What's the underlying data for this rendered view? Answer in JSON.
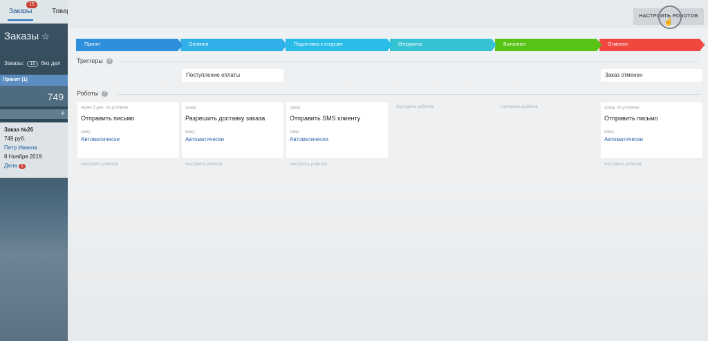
{
  "crm": {
    "tabs": [
      {
        "label": "Заказы",
        "badge": "15"
      },
      {
        "label": "Товар"
      }
    ],
    "title": "Заказы",
    "orders_label": "Заказы:",
    "orders_count": "15",
    "orders_suffix": "без дел",
    "stage_name": "Принят",
    "stage_count": "(1)",
    "stage_sum": "749",
    "add": "+",
    "order": {
      "number": "Заказ №26",
      "price": "749 руб.",
      "client": "Петр Иванов",
      "date": "8 Ноября 2019",
      "deals_label": "Дела",
      "deals_count": "1"
    }
  },
  "toolbar": {
    "setup_robots": "НАСТРОИТЬ РОБОТОВ"
  },
  "stages": [
    {
      "label": "Принят",
      "color": "#2e90dc"
    },
    {
      "label": "Оплачен",
      "color": "#2fb0e8"
    },
    {
      "label": "Подготовка к отгрузке",
      "color": "#29bce8"
    },
    {
      "label": "Отгружено",
      "color": "#35c3d4"
    },
    {
      "label": "Выполнен",
      "color": "#57c314"
    },
    {
      "label": "Отменен",
      "color": "#f0473f"
    }
  ],
  "triggers": {
    "label": "Триггеры",
    "items": [
      {
        "label": "Поступление оплаты"
      },
      {
        "label": "Заказ отменен"
      }
    ]
  },
  "robots": {
    "label": "Роботы",
    "setup_link": "Настроить роботов",
    "cards": [
      {
        "condition": "через 3 дня, по условию",
        "name": "Отправить письмо",
        "to_label": "кому:",
        "to_value": "Автоматически"
      },
      {
        "condition": "сразу",
        "name": "Разрешить доставку заказа",
        "to_label": "кому:",
        "to_value": "Автоматически"
      },
      {
        "condition": "сразу",
        "name": "Отправить SMS клиенту",
        "to_label": "кому:",
        "to_value": "Автоматически"
      },
      {
        "condition": "сразу, по условию",
        "name": "Отправить письмо",
        "to_label": "кому:",
        "to_value": "Автоматически"
      }
    ]
  }
}
